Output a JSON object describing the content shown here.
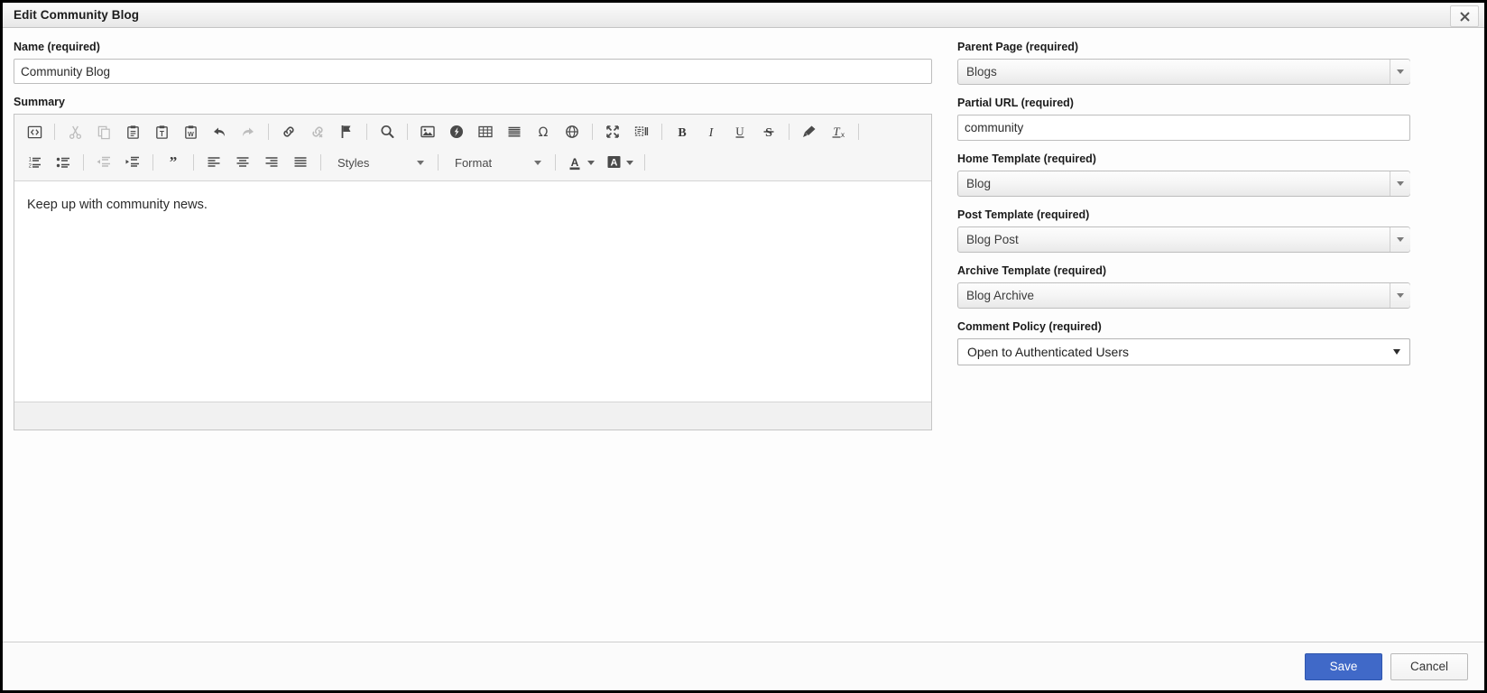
{
  "window": {
    "title": "Edit Community Blog",
    "close_icon": "close-icon"
  },
  "left": {
    "name_label": "Name (required)",
    "name_value": "Community Blog",
    "name_placeholder": "",
    "summary_label": "Summary",
    "editor_content": "Keep up with community news."
  },
  "editor": {
    "toolbar_row1": [
      {
        "name": "source-icon",
        "label": "Source",
        "disabled": false
      },
      {
        "sep": true
      },
      {
        "name": "cut-icon",
        "label": "Cut",
        "disabled": true
      },
      {
        "name": "copy-icon",
        "label": "Copy",
        "disabled": true
      },
      {
        "name": "paste-icon",
        "label": "Paste",
        "disabled": false
      },
      {
        "name": "paste-text-icon",
        "label": "Paste as plain text",
        "disabled": false
      },
      {
        "name": "paste-word-icon",
        "label": "Paste from Word",
        "disabled": false
      },
      {
        "name": "undo-icon",
        "label": "Undo",
        "disabled": false
      },
      {
        "name": "redo-icon",
        "label": "Redo",
        "disabled": true
      },
      {
        "sep": true
      },
      {
        "name": "link-icon",
        "label": "Link",
        "disabled": false
      },
      {
        "name": "unlink-icon",
        "label": "Unlink",
        "disabled": true
      },
      {
        "name": "anchor-flag-icon",
        "label": "Anchor",
        "disabled": false
      },
      {
        "sep": true
      },
      {
        "name": "search-icon",
        "label": "Find",
        "disabled": false
      },
      {
        "sep": true
      },
      {
        "name": "image-icon",
        "label": "Image",
        "disabled": false
      },
      {
        "name": "flash-icon",
        "label": "Flash",
        "disabled": false
      },
      {
        "name": "table-icon",
        "label": "Table",
        "disabled": false
      },
      {
        "name": "horizontal-rule-icon",
        "label": "Horizontal Line",
        "disabled": false
      },
      {
        "name": "special-character-icon",
        "label": "Special Character",
        "disabled": false
      },
      {
        "name": "iframe-globe-icon",
        "label": "IFrame",
        "disabled": false
      },
      {
        "sep": true
      },
      {
        "name": "maximize-icon",
        "label": "Maximize",
        "disabled": false
      },
      {
        "name": "show-blocks-icon",
        "label": "Show Blocks",
        "disabled": false
      },
      {
        "sep": true
      },
      {
        "name": "bold-icon",
        "label": "Bold",
        "disabled": false
      },
      {
        "name": "italic-icon",
        "label": "Italic",
        "disabled": false
      },
      {
        "name": "underline-icon",
        "label": "Underline",
        "disabled": false
      },
      {
        "name": "strikethrough-icon",
        "label": "Strikethrough",
        "disabled": false
      },
      {
        "sep": true
      },
      {
        "name": "copy-formatting-icon",
        "label": "Copy Formatting",
        "disabled": false
      },
      {
        "name": "remove-format-icon",
        "label": "Remove Format",
        "disabled": false
      },
      {
        "sep": true
      }
    ],
    "toolbar_row2": [
      {
        "name": "numbered-list-icon",
        "label": "Insert/Remove Numbered List",
        "disabled": false
      },
      {
        "name": "bulleted-list-icon",
        "label": "Insert/Remove Bulleted List",
        "disabled": false
      },
      {
        "sep": true
      },
      {
        "name": "outdent-icon",
        "label": "Decrease Indent",
        "disabled": true
      },
      {
        "name": "indent-icon",
        "label": "Increase Indent",
        "disabled": false
      },
      {
        "sep": true
      },
      {
        "name": "blockquote-icon",
        "label": "Block Quote",
        "disabled": false
      },
      {
        "sep": true
      },
      {
        "name": "align-left-icon",
        "label": "Align Left",
        "disabled": false
      },
      {
        "name": "align-center-icon",
        "label": "Center",
        "disabled": false
      },
      {
        "name": "align-right-icon",
        "label": "Align Right",
        "disabled": false
      },
      {
        "name": "align-justify-icon",
        "label": "Justify",
        "disabled": false
      },
      {
        "sep": true
      }
    ],
    "styles_label": "Styles",
    "format_label": "Format",
    "text_color_label": "Text Color",
    "bg_color_label": "Background Color"
  },
  "right": {
    "parent_page_label": "Parent Page (required)",
    "parent_page_value": "Blogs",
    "partial_url_label": "Partial URL (required)",
    "partial_url_value": "community",
    "home_template_label": "Home Template (required)",
    "home_template_value": "Blog",
    "post_template_label": "Post Template (required)",
    "post_template_value": "Blog Post",
    "archive_template_label": "Archive Template (required)",
    "archive_template_value": "Blog Archive",
    "comment_policy_label": "Comment Policy (required)",
    "comment_policy_value": "Open to Authenticated Users"
  },
  "footer": {
    "save_label": "Save",
    "cancel_label": "Cancel"
  },
  "colors": {
    "primary": "#4069c8",
    "toolbar_bg": "#f6f6f6",
    "border": "#c5c5c5"
  }
}
